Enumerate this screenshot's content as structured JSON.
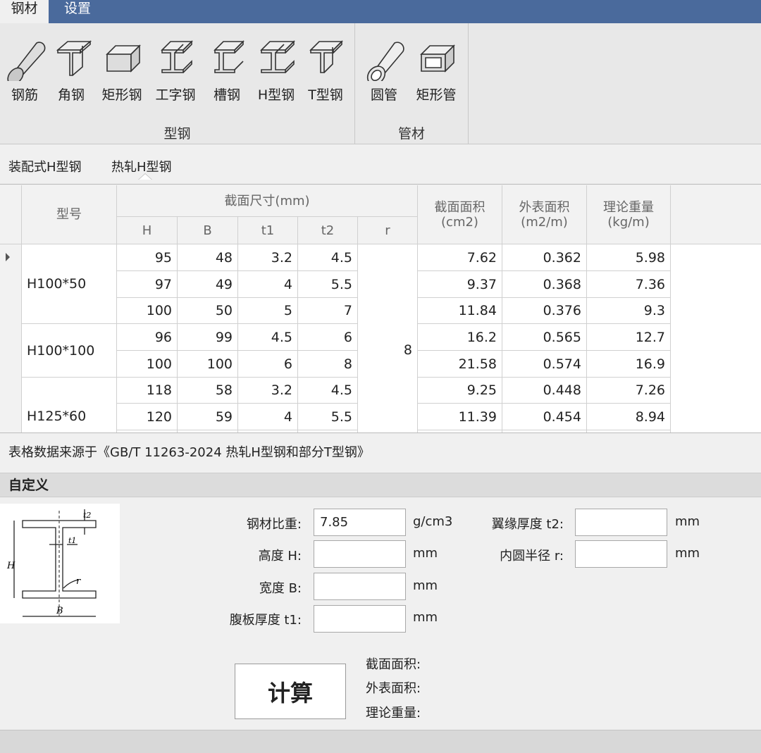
{
  "menu": {
    "tabs": [
      "钢材",
      "设置"
    ]
  },
  "ribbon": {
    "groups": [
      {
        "label": "型钢",
        "items": [
          "钢筋",
          "角钢",
          "矩形钢",
          "工字钢",
          "槽钢",
          "H型钢",
          "T型钢"
        ]
      },
      {
        "label": "管材",
        "items": [
          "圆管",
          "矩形管"
        ]
      }
    ],
    "icons": [
      "rebar-icon",
      "angle-steel-icon",
      "rect-steel-icon",
      "i-beam-icon",
      "channel-steel-icon",
      "h-beam-icon",
      "t-beam-icon",
      "round-tube-icon",
      "rect-tube-icon"
    ]
  },
  "subtabs": [
    "装配式H型钢",
    "热轧H型钢"
  ],
  "table": {
    "headers": {
      "model": "型号",
      "section_size": "截面尺寸(mm)",
      "H": "H",
      "B": "B",
      "t1": "t1",
      "t2": "t2",
      "r": "r",
      "area": "截面面积\n(cm2)",
      "surface": "外表面积\n(m2/m)",
      "weight": "理论重量\n(kg/m)"
    },
    "groups": [
      "H100*50",
      "H100*100",
      "H125*60"
    ],
    "r_value": "8",
    "rows": [
      [
        "95",
        "48",
        "3.2",
        "4.5",
        "7.62",
        "0.362",
        "5.98"
      ],
      [
        "97",
        "49",
        "4",
        "5.5",
        "9.37",
        "0.368",
        "7.36"
      ],
      [
        "100",
        "50",
        "5",
        "7",
        "11.84",
        "0.376",
        "9.3"
      ],
      [
        "96",
        "99",
        "4.5",
        "6",
        "16.2",
        "0.565",
        "12.7"
      ],
      [
        "100",
        "100",
        "6",
        "8",
        "21.58",
        "0.574",
        "16.9"
      ],
      [
        "118",
        "58",
        "3.2",
        "4.5",
        "9.25",
        "0.448",
        "7.26"
      ],
      [
        "120",
        "59",
        "4",
        "5.5",
        "11.39",
        "0.454",
        "8.94"
      ]
    ]
  },
  "source": "表格数据来源于《GB/T 11263-2024 热轧H型钢和部分T型钢》",
  "custom": {
    "title": "自定义",
    "diagram_labels": {
      "t2": "t2",
      "t1": "t1",
      "H": "H",
      "r": "r",
      "B": "B"
    },
    "density_label": "钢材比重:",
    "density_value": "7.85",
    "density_unit": "g/cm3",
    "height_label": "高度 H:",
    "width_label": "宽度 B:",
    "web_label": "腹板厚度 t1:",
    "flange_label": "翼缘厚度 t2:",
    "radius_label": "内圆半径 r:",
    "mm": "mm",
    "calc_button": "计算",
    "result_area": "截面面积:",
    "result_surface": "外表面积:",
    "result_weight": "理论重量:"
  }
}
